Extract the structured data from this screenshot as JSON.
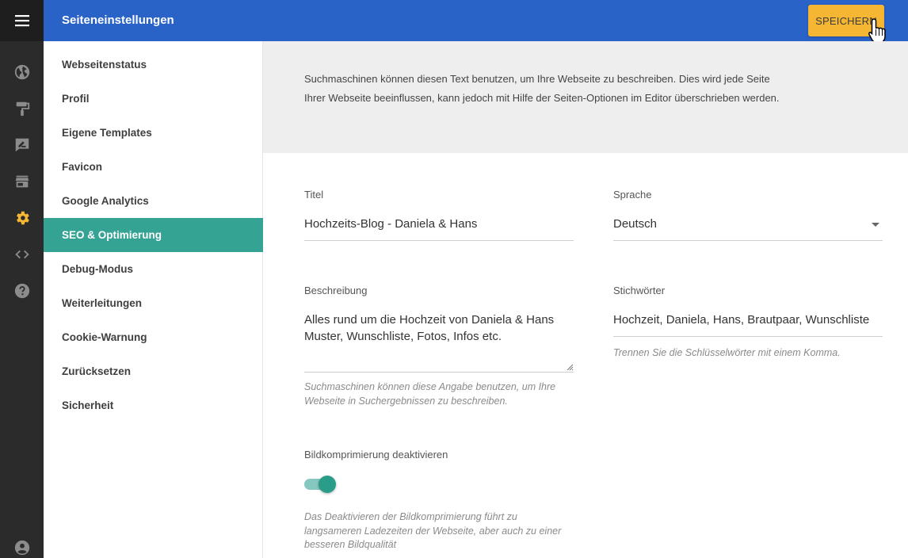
{
  "rail": {
    "icons": [
      "menu-icon",
      "globe-icon",
      "paint-roller-icon",
      "edit-note-icon",
      "store-icon",
      "gear-icon",
      "code-icon",
      "help-icon",
      "account-icon"
    ],
    "active_icon": "gear-icon",
    "accent_color": "#f5b733"
  },
  "header": {
    "title": "Seiteneinstellungen",
    "save_label": "SPEICHERN",
    "color": "#2a63c8"
  },
  "menu": {
    "items": [
      {
        "label": "Webseitenstatus"
      },
      {
        "label": "Profil"
      },
      {
        "label": "Eigene Templates"
      },
      {
        "label": "Favicon"
      },
      {
        "label": "Google Analytics"
      },
      {
        "label": "SEO & Optimierung"
      },
      {
        "label": "Debug-Modus"
      },
      {
        "label": "Weiterleitungen"
      },
      {
        "label": "Cookie-Warnung"
      },
      {
        "label": "Zurücksetzen"
      },
      {
        "label": "Sicherheit"
      }
    ],
    "active_label": "SEO & Optimierung",
    "active_color": "#35a394"
  },
  "content": {
    "intro": "Suchmaschinen können diesen Text benutzen, um Ihre Webseite zu beschreiben. Dies wird jede Seite Ihrer Webseite beeinflussen, kann jedoch mit Hilfe der Seiten-Optionen im Editor überschrieben werden.",
    "title_label": "Titel",
    "title_value": "Hochzeits-Blog - Daniela & Hans",
    "language_label": "Sprache",
    "language_value": "Deutsch",
    "description_label": "Beschreibung",
    "description_value": "Alles rund um die Hochzeit von Daniela & Hans Muster, Wunschliste, Fotos, Infos etc.",
    "description_hint": "Suchmaschinen können diese Angabe benutzen, um Ihre Webseite in Suchergebnissen zu beschreiben.",
    "keywords_label": "Stichwörter",
    "keywords_value": "Hochzeit, Daniela, Hans, Brautpaar, Wunschliste",
    "keywords_hint": "Trennen Sie die Schlüsselwörter mit einem Komma.",
    "compression_label": "Bildkomprimierung deaktivieren",
    "compression_enabled": true,
    "compression_hint": "Das Deaktivieren der Bildkomprimierung führt zu langsameren Ladezeiten der Webseite, aber auch zu einer besseren Bildqualität"
  }
}
